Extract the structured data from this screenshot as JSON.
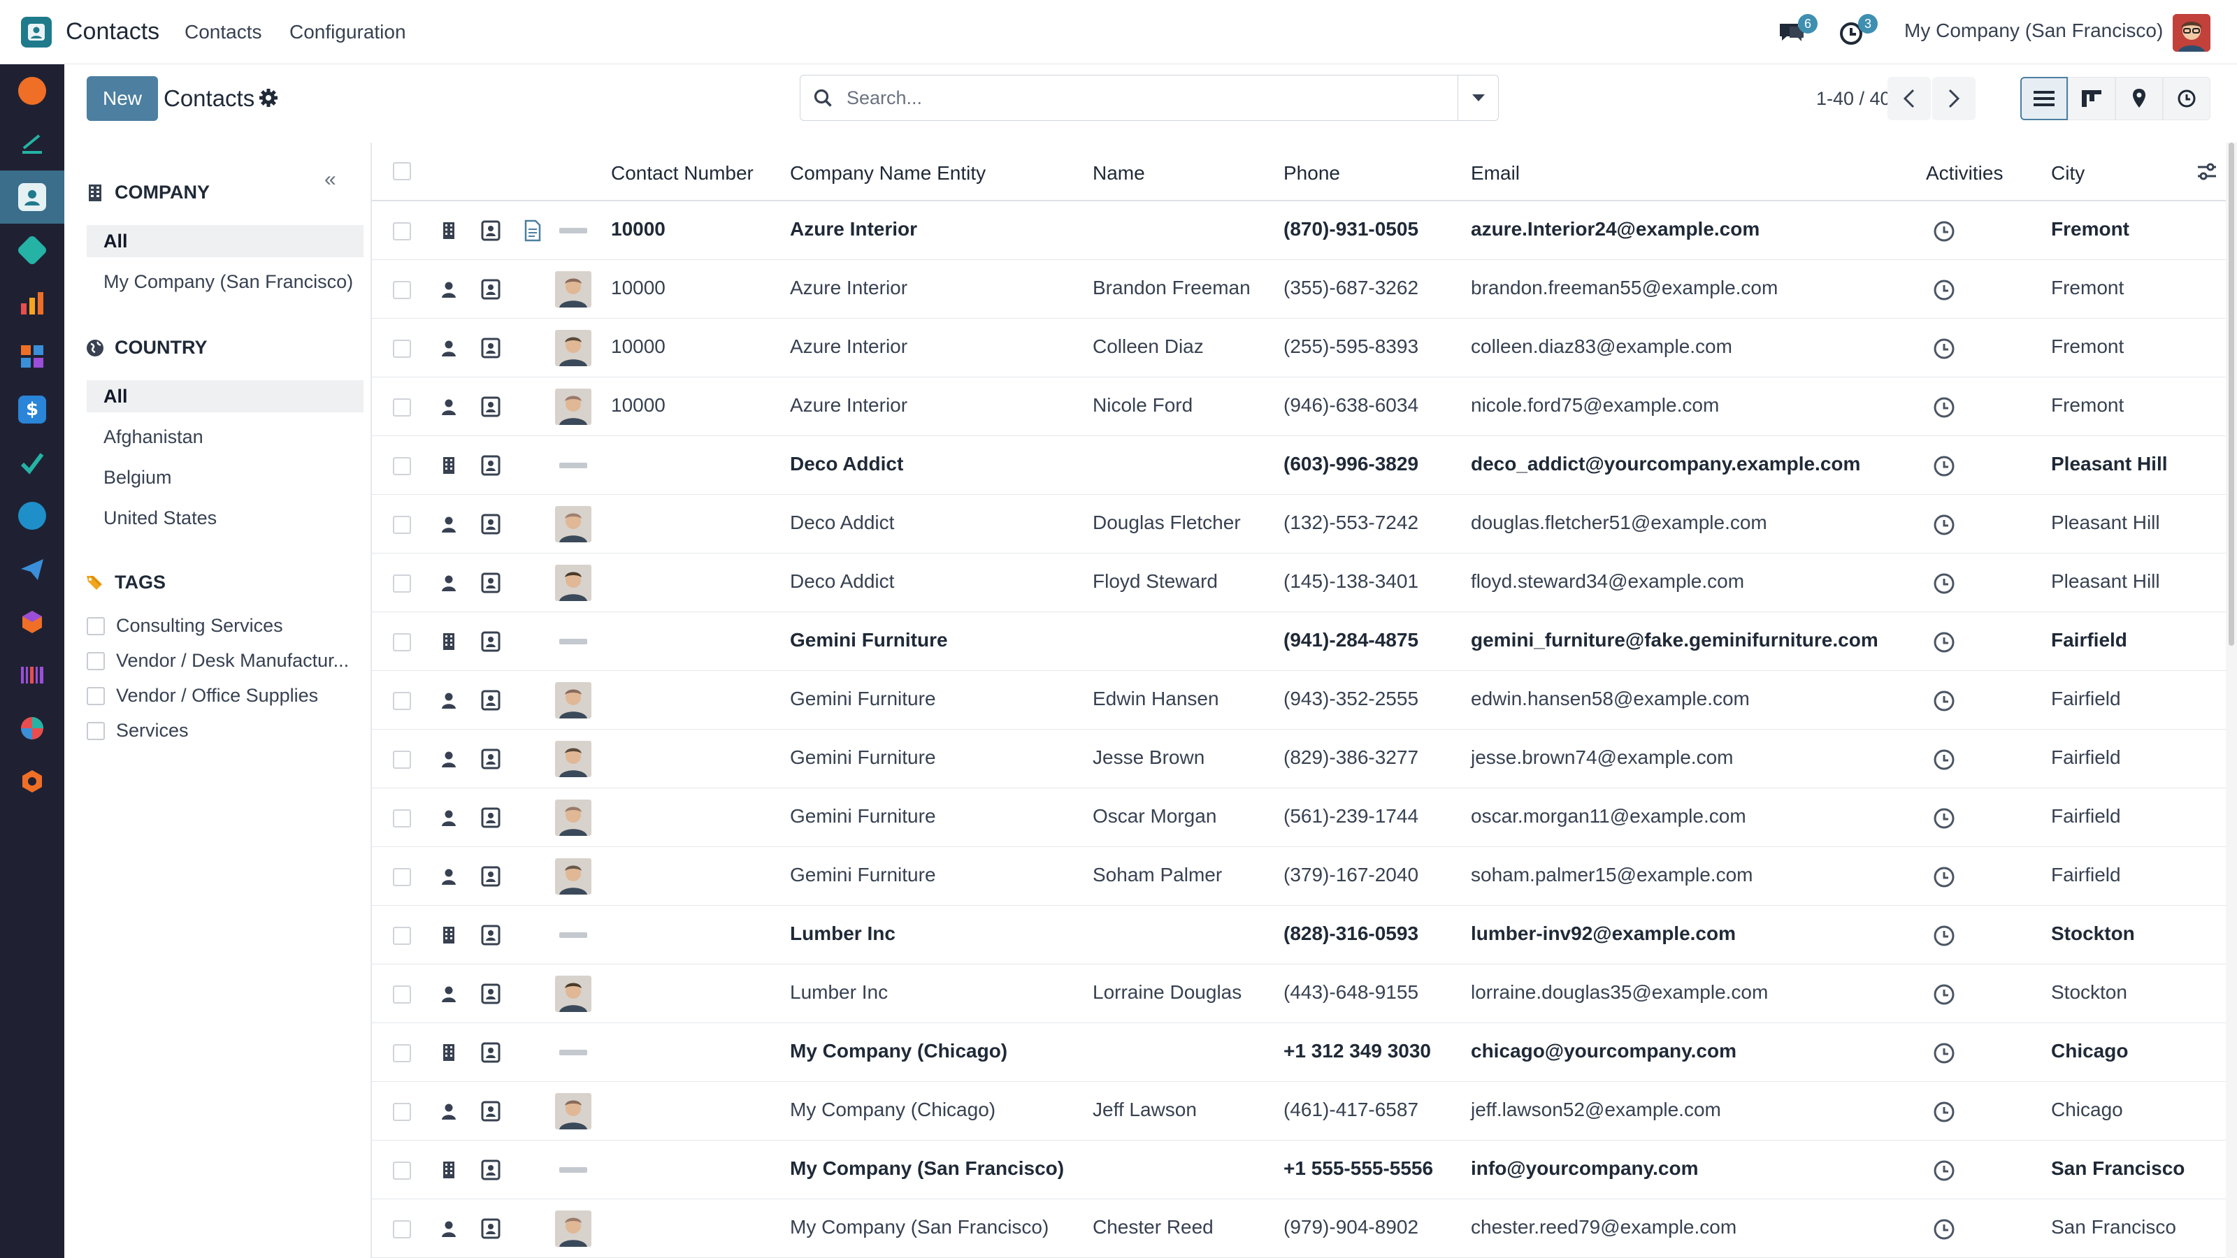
{
  "topnav": {
    "app_name": "Contacts",
    "menu": [
      "Contacts",
      "Configuration"
    ],
    "messages_badge": "6",
    "activities_badge": "3",
    "company": "My Company (San Francisco)"
  },
  "control": {
    "new_label": "New",
    "breadcrumb": "Contacts",
    "search_placeholder": "Search...",
    "pager": "1-40 / 40"
  },
  "search_panel": {
    "company_title": "COMPANY",
    "company_items": [
      "All",
      "My Company (San Francisco)"
    ],
    "country_title": "COUNTRY",
    "country_items": [
      "All",
      "Afghanistan",
      "Belgium",
      "United States"
    ],
    "tags_title": "TAGS",
    "tags": [
      "Consulting Services",
      "Vendor / Desk Manufactur...",
      "Vendor / Office Supplies",
      "Services"
    ]
  },
  "table": {
    "columns": [
      "Contact Number",
      "Company Name Entity",
      "Name",
      "Phone",
      "Email",
      "Activities",
      "City"
    ],
    "rows": [
      {
        "company_type": true,
        "doc": true,
        "number": "10000",
        "company": "Azure Interior",
        "name": "",
        "phone": "(870)-931-0505",
        "email": "azure.Interior24@example.com",
        "city": "Fremont"
      },
      {
        "company_type": false,
        "number": "10000",
        "company": "Azure Interior",
        "name": "Brandon Freeman",
        "phone": "(355)-687-3262",
        "email": "brandon.freeman55@example.com",
        "city": "Fremont"
      },
      {
        "company_type": false,
        "number": "10000",
        "company": "Azure Interior",
        "name": "Colleen Diaz",
        "phone": "(255)-595-8393",
        "email": "colleen.diaz83@example.com",
        "city": "Fremont"
      },
      {
        "company_type": false,
        "number": "10000",
        "company": "Azure Interior",
        "name": "Nicole Ford",
        "phone": "(946)-638-6034",
        "email": "nicole.ford75@example.com",
        "city": "Fremont"
      },
      {
        "company_type": true,
        "number": "",
        "company": "Deco Addict",
        "name": "",
        "phone": "(603)-996-3829",
        "email": "deco_addict@yourcompany.example.com",
        "city": "Pleasant Hill"
      },
      {
        "company_type": false,
        "number": "",
        "company": "Deco Addict",
        "name": "Douglas Fletcher",
        "phone": "(132)-553-7242",
        "email": "douglas.fletcher51@example.com",
        "city": "Pleasant Hill"
      },
      {
        "company_type": false,
        "number": "",
        "company": "Deco Addict",
        "name": "Floyd Steward",
        "phone": "(145)-138-3401",
        "email": "floyd.steward34@example.com",
        "city": "Pleasant Hill"
      },
      {
        "company_type": true,
        "number": "",
        "company": "Gemini Furniture",
        "name": "",
        "phone": "(941)-284-4875",
        "email": "gemini_furniture@fake.geminifurniture.com",
        "city": "Fairfield"
      },
      {
        "company_type": false,
        "number": "",
        "company": "Gemini Furniture",
        "name": "Edwin Hansen",
        "phone": "(943)-352-2555",
        "email": "edwin.hansen58@example.com",
        "city": "Fairfield"
      },
      {
        "company_type": false,
        "number": "",
        "company": "Gemini Furniture",
        "name": "Jesse Brown",
        "phone": "(829)-386-3277",
        "email": "jesse.brown74@example.com",
        "city": "Fairfield"
      },
      {
        "company_type": false,
        "number": "",
        "company": "Gemini Furniture",
        "name": "Oscar Morgan",
        "phone": "(561)-239-1744",
        "email": "oscar.morgan11@example.com",
        "city": "Fairfield"
      },
      {
        "company_type": false,
        "number": "",
        "company": "Gemini Furniture",
        "name": "Soham Palmer",
        "phone": "(379)-167-2040",
        "email": "soham.palmer15@example.com",
        "city": "Fairfield"
      },
      {
        "company_type": true,
        "number": "",
        "company": "Lumber Inc",
        "name": "",
        "phone": "(828)-316-0593",
        "email": "lumber-inv92@example.com",
        "city": "Stockton"
      },
      {
        "company_type": false,
        "number": "",
        "company": "Lumber Inc",
        "name": "Lorraine Douglas",
        "phone": "(443)-648-9155",
        "email": "lorraine.douglas35@example.com",
        "city": "Stockton"
      },
      {
        "company_type": true,
        "number": "",
        "company": "My Company (Chicago)",
        "name": "",
        "phone": "+1 312 349 3030",
        "email": "chicago@yourcompany.com",
        "city": "Chicago"
      },
      {
        "company_type": false,
        "number": "",
        "company": "My Company (Chicago)",
        "name": "Jeff Lawson",
        "phone": "(461)-417-6587",
        "email": "jeff.lawson52@example.com",
        "city": "Chicago"
      },
      {
        "company_type": true,
        "number": "",
        "company": "My Company (San Francisco)",
        "name": "",
        "phone": "+1 555-555-5556",
        "email": "info@yourcompany.com",
        "city": "San Francisco"
      },
      {
        "company_type": false,
        "number": "",
        "company": "My Company (San Francisco)",
        "name": "Chester Reed",
        "phone": "(979)-904-8902",
        "email": "chester.reed79@example.com",
        "city": "San Francisco"
      }
    ]
  },
  "colors": {
    "brand": "#4c7fa0",
    "appbar": "#1f2133",
    "badge": "#3e8fb0"
  }
}
